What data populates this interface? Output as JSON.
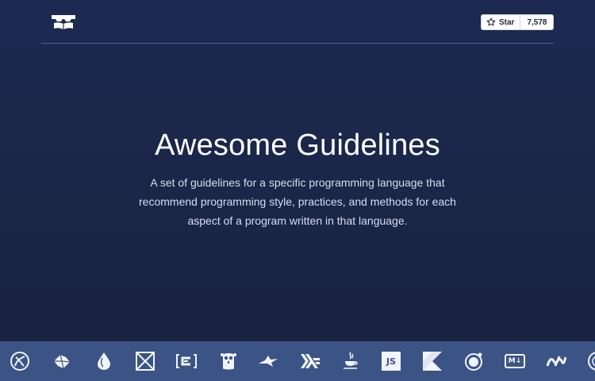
{
  "header": {
    "logo_icon": "glasses-book-logo-icon",
    "github": {
      "star_icon": "star-outline-icon",
      "star_label": "Star",
      "star_count": "7,578"
    }
  },
  "hero": {
    "title": "Awesome Guidelines",
    "description": "A set of guidelines for a specific programming language that recommend programming style, practices, and methods for each aspect of a program written in that language."
  },
  "languages": [
    {
      "name": "clojure-icon"
    },
    {
      "name": "elm-icon"
    },
    {
      "name": "elixir-icon"
    },
    {
      "name": "haskell-lambda-icon"
    },
    {
      "name": "brackets-c-icon",
      "label": "[-e]"
    },
    {
      "name": "gopher-icon"
    },
    {
      "name": "objective-c-icon"
    },
    {
      "name": "haskell-icon"
    },
    {
      "name": "java-icon"
    },
    {
      "name": "javascript-icon",
      "label": "JS"
    },
    {
      "name": "kotlin-icon"
    },
    {
      "name": "swift-icon"
    },
    {
      "name": "markdown-icon",
      "label": "M↓"
    },
    {
      "name": "dotnet-icon",
      "label": "/ /"
    },
    {
      "name": "php-icon"
    }
  ],
  "colors": {
    "background_top": "#1c2a52",
    "background_bottom": "#18213d",
    "language_strip": "#3c5385",
    "icon_fill": "#f1f4fb"
  }
}
